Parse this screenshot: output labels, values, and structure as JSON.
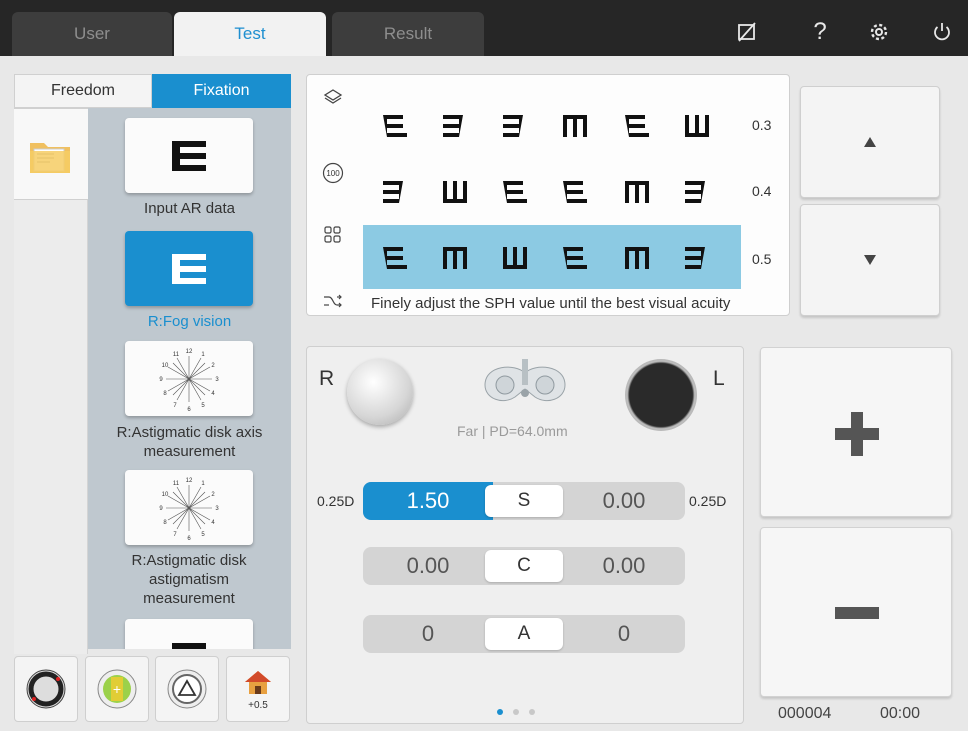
{
  "tabs": [
    {
      "label": "User",
      "active": false
    },
    {
      "label": "Test",
      "active": true
    },
    {
      "label": "Result",
      "active": false
    }
  ],
  "top_icons": [
    "no-chart-icon",
    "help-icon",
    "settings-icon",
    "power-icon"
  ],
  "top_icon_glyphs": {
    "help": "?"
  },
  "modes": {
    "freedom": "Freedom",
    "fixation": "Fixation",
    "selected": "Fixation"
  },
  "program_list": [
    {
      "label": "Input AR data",
      "selected": false
    },
    {
      "label": "R:Fog vision",
      "selected": true
    },
    {
      "label": "R:Astigmatic disk axis measurement",
      "selected": false
    },
    {
      "label": "R:Astigmatic disk astigmatism measurement",
      "selected": false
    }
  ],
  "bottom_tools": {
    "home_value": "+0.5"
  },
  "chart": {
    "rows": [
      {
        "acuity": "0.3",
        "highlighted": false
      },
      {
        "acuity": "0.4",
        "highlighted": false
      },
      {
        "acuity": "0.5",
        "highlighted": true
      }
    ],
    "side_icons": {
      "hundred": "100"
    },
    "hint": "Finely adjust the SPH value until the best visual acuity"
  },
  "control": {
    "right_eye": "R",
    "left_eye": "L",
    "pd_text": "Far | PD=64.0mm",
    "rows": [
      {
        "left": "1.50",
        "mid": "S",
        "right": "0.00",
        "step_left": "0.25D",
        "step_right": "0.25D",
        "active": true
      },
      {
        "left": "0.00",
        "mid": "C",
        "right": "0.00",
        "active": false
      },
      {
        "left": "0",
        "mid": "A",
        "right": "0",
        "active": false
      }
    ],
    "page_dots": 3,
    "active_dot": 0
  },
  "footer": {
    "counter": "000004",
    "time": "00:00"
  },
  "colors": {
    "accent": "#1a8fcf",
    "highlight": "#8ccae3"
  }
}
